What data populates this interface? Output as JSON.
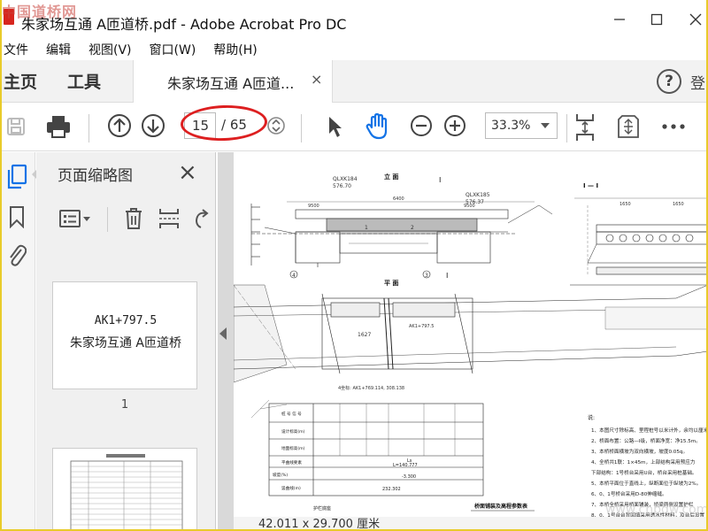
{
  "window": {
    "title": "朱家场互通 A匝道桥.pdf - Adobe Acrobat Pro DC",
    "watermark": "中国道桥网",
    "minimize_icon": "minimize-icon",
    "maximize_icon": "maximize-icon",
    "close_icon": "close-icon"
  },
  "menu": [
    "文件",
    "编辑",
    "视图(V)",
    "窗口(W)",
    "帮助(H)"
  ],
  "tabs": {
    "home": "主页",
    "tools": "工具",
    "document": "朱家场互通 A匝道...",
    "help": "?"
  },
  "toolbar": {
    "current_page": "15",
    "total_pages": "/ 65",
    "zoom": "33.3%"
  },
  "thumbnails": {
    "title": "页面缩略图",
    "page1_line1": "AK1+797.5",
    "page1_line2": "朱家场互通 A匝道桥",
    "page1_number": "1"
  },
  "drawing": {
    "elevation_title": "立 面",
    "plan_title": "平 面",
    "section_title": "I — I",
    "label_qlxk184": "QLXK184",
    "label_57670": "576.70",
    "label_qlxk185": "QLXK185",
    "label_57637": "576.37",
    "label_ak1": "AK1+797.5",
    "dims": [
      "9500",
      "6400",
      "9500",
      "1650",
      "1650",
      "1627",
      "1",
      "2",
      "3",
      "4",
      "I",
      "I"
    ],
    "table_title": "桥面铺装及高程参数表",
    "table_rows": [
      "桩 号 信 号",
      "设计标高(m)",
      "地面标高(m)",
      "平曲线要素",
      "坡度(%)",
      "竖曲线(m)"
    ],
    "table_values": [
      "Ls",
      "L=140.777",
      "-3.300",
      "232.302"
    ],
    "coord_text": "4坐标: AK1+769.114, 308.138",
    "notes_header": "说:",
    "notes": [
      "1、本图尺寸除标高、里程桩号以米计外，余均以厘米计。",
      "2、桥面布置：公路—I级，桥面净宽：净15.5m。",
      "3、本桥桥面横坡为双向横坡，坡度0.05q。",
      "4、全桥共1联：1×45m，上部结构采用预应力",
      "   下部结构：1号桥台采用U台，桥台采用桩基础。",
      "5、本桥平面位于直线上，纵断面位于纵坡为2%。",
      "6、0、1号桥台采用D-80伸缩缝。",
      "7、本桥全桥采用桥面铺装，桥梁两侧设置护栏",
      "8、0、1号台台背回填采用透水性材料，及台后设置"
    ],
    "footer_left": "护栏底座",
    "site_watermark": "www.cnbdw.com"
  },
  "status": {
    "size": "42.011 x 29.700 厘米"
  },
  "colors": {
    "frame": "#e9cb2a",
    "highlight": "#dd1f20",
    "accent": "#1473e6",
    "app_red": "#d7261e"
  }
}
